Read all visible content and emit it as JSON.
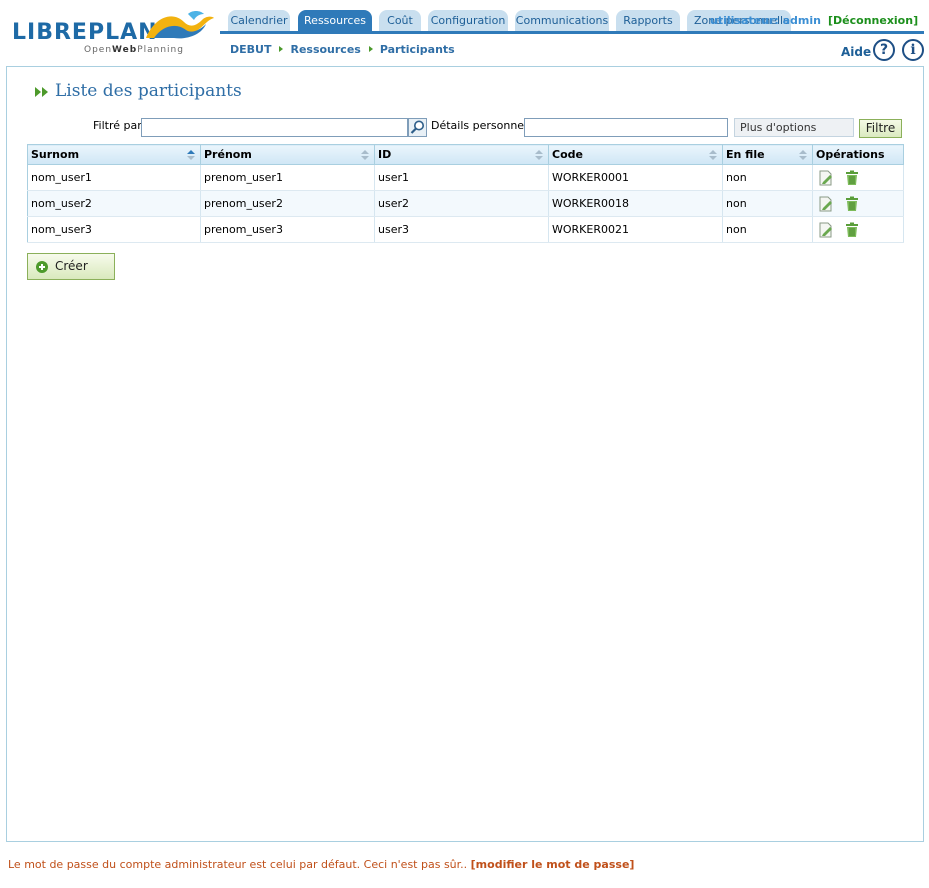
{
  "header": {
    "logo": {
      "brand": "LIBREPLAN",
      "tagline_prefix": "Open",
      "tagline_bold": "Web",
      "tagline_suffix": "Planning"
    },
    "tabs": [
      {
        "label": "Calendrier",
        "active": false
      },
      {
        "label": "Ressources",
        "active": true
      },
      {
        "label": "Coût",
        "active": false
      },
      {
        "label": "Configuration",
        "active": false
      },
      {
        "label": "Communications",
        "active": false
      },
      {
        "label": "Rapports",
        "active": false
      },
      {
        "label": "Zone personnelle",
        "active": false
      }
    ],
    "user": "utilisateur: admin",
    "logout": "[Déconnexion]",
    "breadcrumb": [
      "DEBUT",
      "Ressources",
      "Participants"
    ],
    "help_label": "Aide",
    "help_glyph": "?",
    "info_glyph": "i"
  },
  "page": {
    "title": "Liste des participants",
    "filter": {
      "label": "Filtré par",
      "value": "",
      "details_label": "Détails personnels",
      "details_value": "",
      "more_options": "Plus d'options",
      "button": "Filtre"
    },
    "table": {
      "columns": [
        "Surnom",
        "Prénom",
        "ID",
        "Code",
        "En file",
        "Opérations"
      ],
      "rows": [
        {
          "surnom": "nom_user1",
          "prenom": "prenom_user1",
          "id": "user1",
          "code": "WORKER0001",
          "en_file": "non"
        },
        {
          "surnom": "nom_user2",
          "prenom": "prenom_user2",
          "id": "user2",
          "code": "WORKER0018",
          "en_file": "non"
        },
        {
          "surnom": "nom_user3",
          "prenom": "prenom_user3",
          "id": "user3",
          "code": "WORKER0021",
          "en_file": "non"
        }
      ]
    },
    "create_button": "Créer"
  },
  "footer": {
    "warning": "Le mot de passe du compte administrateur est celui par défaut. Ceci n'est pas sûr..",
    "link": "[modifier le mot de passe]"
  },
  "icons": {
    "search": "search-icon",
    "edit": "edit-icon",
    "delete": "trash-icon",
    "add": "plus-circle-icon",
    "title": "double-chevron-icon"
  },
  "colors": {
    "brand_blue": "#2f7ab9",
    "tab_inactive": "#c9dfef",
    "logout_green": "#1c8f1c",
    "warning_orange": "#c0501a"
  }
}
